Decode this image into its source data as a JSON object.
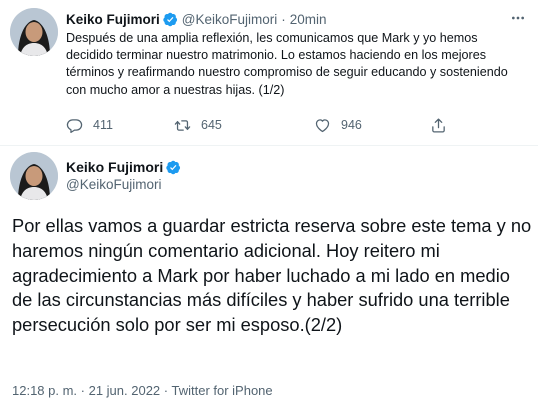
{
  "tweet1": {
    "name": "Keiko Fujimori",
    "handle": "@KeikoFujimori",
    "separator": "·",
    "time": "20min",
    "text": "Después de una amplia reflexión, les comunicamos que Mark y yo hemos decidido terminar nuestro matrimonio. Lo estamos haciendo en los mejores términos y reafirmando nuestro compromiso de seguir educando y sosteniendo con mucho amor a nuestras hijas. (1/2)",
    "replies": "411",
    "retweets": "645",
    "likes": "946"
  },
  "tweet2": {
    "name": "Keiko Fujimori",
    "handle": "@KeikoFujimori",
    "text": "Por ellas vamos a guardar estricta reserva sobre este tema y no haremos ningún comentario adicional. Hoy reitero mi agradecimiento a Mark por haber luchado a mi lado en medio de las circunstancias más difíciles y haber sufrido una terrible persecución solo por ser mi esposo.(2/2)",
    "timestamp": "12:18 p. m. · 21 jun. 2022 · ",
    "source": "Twitter for iPhone"
  },
  "icons": {
    "verified": "verified-badge-icon",
    "more": "more-dots-icon",
    "reply": "reply-icon",
    "retweet": "retweet-icon",
    "like": "heart-icon",
    "share": "share-icon"
  },
  "colors": {
    "verified": "#1d9bf0",
    "secondary_text": "#536471",
    "primary_text": "#0f1419",
    "divider": "#eff3f4"
  }
}
